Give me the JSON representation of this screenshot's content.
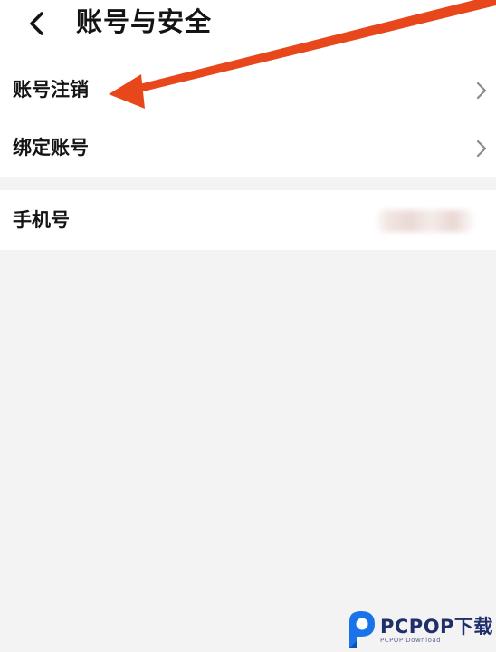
{
  "header": {
    "title": "账号与安全",
    "back_icon": "chevron-left-icon"
  },
  "settings": {
    "group1": [
      {
        "label": "账号注销",
        "icon": "chevron-right-icon"
      },
      {
        "label": "绑定账号",
        "icon": "chevron-right-icon"
      }
    ],
    "group2": [
      {
        "label": "手机号",
        "value_hidden": true
      }
    ]
  },
  "annotation": {
    "arrow_color": "#e8471c",
    "icon": "red-arrow-annotation"
  },
  "watermark": {
    "brand": "PCPOP下载",
    "sub": "PCPOP Download",
    "logo_color": "#1a73e8"
  },
  "colors": {
    "background": "#f3f3f3",
    "surface": "#ffffff",
    "text": "#141414",
    "chevron": "#8a8a8a"
  }
}
